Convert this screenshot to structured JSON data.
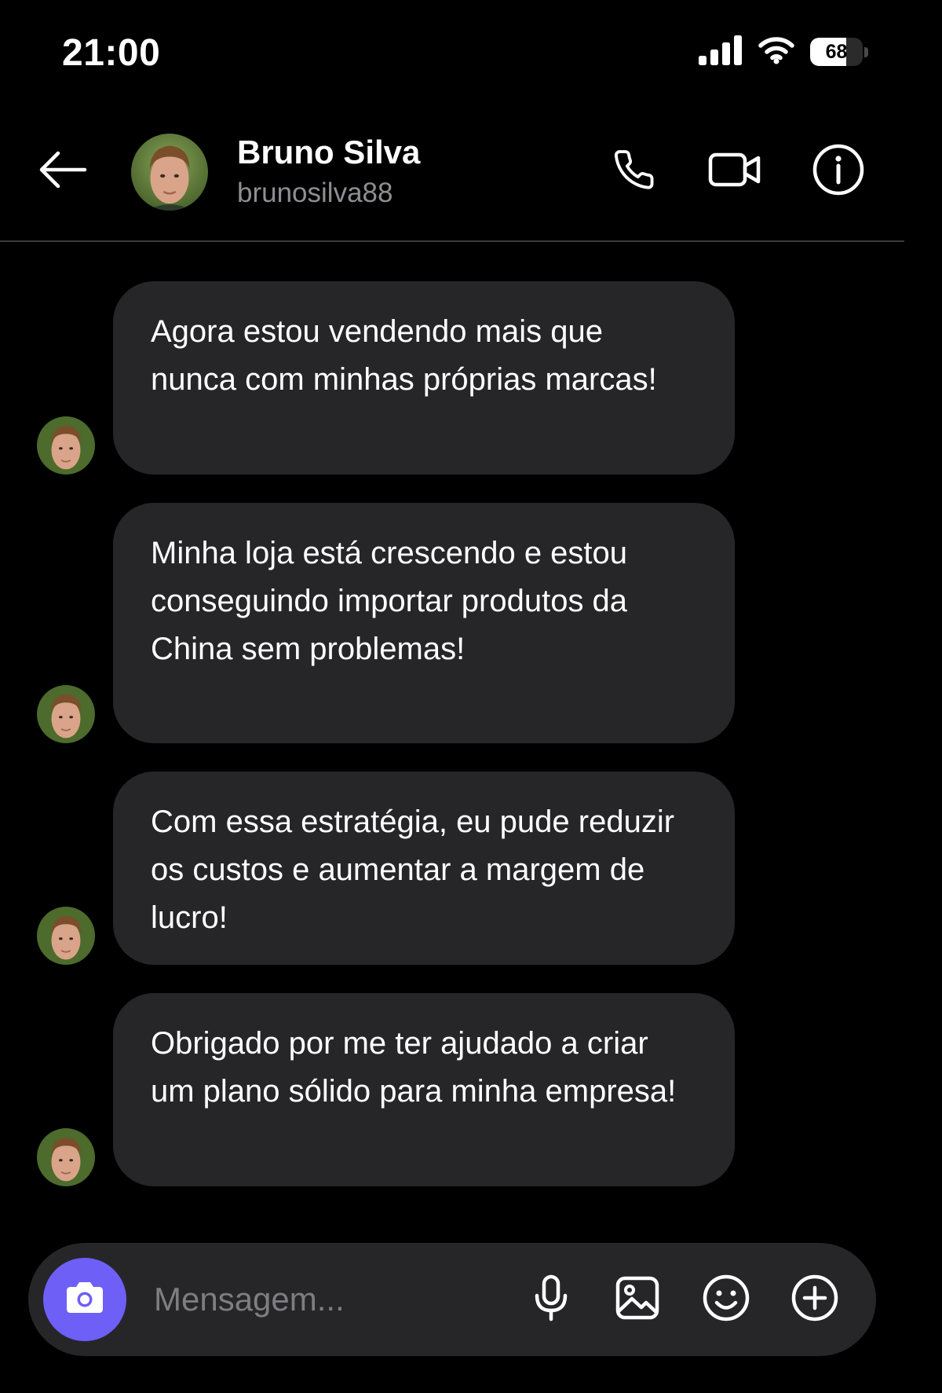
{
  "status_bar": {
    "time": "21:00",
    "battery_level": "68",
    "icons": [
      "cellular-signal-icon",
      "wifi-icon",
      "battery-icon"
    ]
  },
  "header": {
    "name": "Bruno Silva",
    "username": "brunosilva88",
    "icons": [
      "back-arrow-icon",
      "phone-icon",
      "video-camera-icon",
      "info-icon"
    ]
  },
  "messages": [
    {
      "text": "Agora estou vendendo mais que nunca com minhas próprias marcas!"
    },
    {
      "text": "Minha loja está crescendo e estou conseguindo importar produtos da China sem problemas!"
    },
    {
      "text": "Com essa estratégia, eu pude reduzir os custos e aumentar a margem de lucro!"
    },
    {
      "text": "Obrigado por me ter ajudado a criar um plano sólido para minha empresa!"
    }
  ],
  "composer": {
    "placeholder": "Mensagem...",
    "value": "",
    "icons": [
      "camera-icon",
      "microphone-icon",
      "image-icon",
      "emoji-icon",
      "plus-circle-icon"
    ]
  },
  "colors": {
    "background": "#000000",
    "bubble": "#262628",
    "accent": "#6E5FF7",
    "secondary_text": "#8E8E93"
  }
}
